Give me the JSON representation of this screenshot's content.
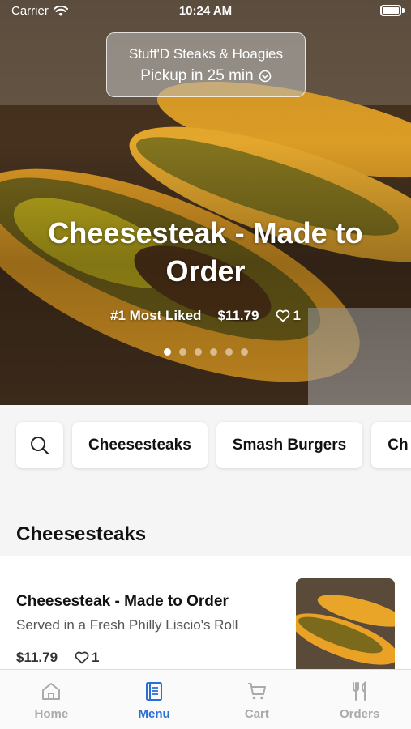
{
  "status_bar": {
    "carrier": "Carrier",
    "time": "10:24 AM"
  },
  "pickup": {
    "store_name": "Stuff'D Steaks & Hoagies",
    "time_label": "Pickup in 25 min"
  },
  "hero": {
    "title": "Cheesesteak - Made to Order",
    "badge": "#1 Most Liked",
    "price": "$11.79",
    "likes": "1",
    "slide_count": 6,
    "active_slide": 0
  },
  "categories": [
    "Cheesesteaks",
    "Smash Burgers",
    "Ch"
  ],
  "section": {
    "title": "Cheesesteaks"
  },
  "item": {
    "name": "Cheesesteak - Made to Order",
    "description": "Served in a Fresh Philly Liscio's Roll",
    "price": "$11.79",
    "likes": "1"
  },
  "tabs": [
    {
      "label": "Home",
      "icon": "home-icon"
    },
    {
      "label": "Menu",
      "icon": "menu-icon"
    },
    {
      "label": "Cart",
      "icon": "cart-icon"
    },
    {
      "label": "Orders",
      "icon": "fork-knife-icon"
    }
  ],
  "active_tab": "Menu",
  "colors": {
    "accent": "#2b6fd6",
    "inactive_tab": "#aaaaaa"
  }
}
